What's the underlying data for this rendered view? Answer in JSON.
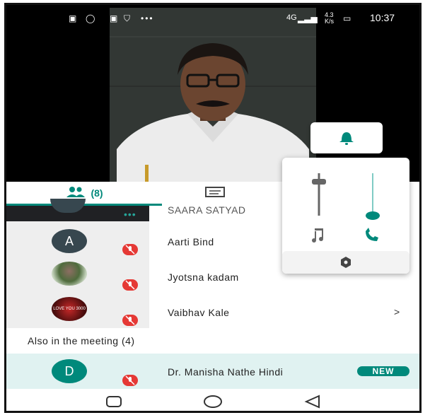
{
  "status_bar": {
    "time": "10:37",
    "network_speed": "4.3\nK/s",
    "signal_label": "4G"
  },
  "colors": {
    "accent": "#00897b",
    "mute_red": "#e53935",
    "also_row_bg": "#e0f2f1"
  },
  "tabs": {
    "people_label": "(8)",
    "people_icon": "people-icon",
    "chat_icon": "chat-icon"
  },
  "participants": [
    {
      "initial": "",
      "name": "SAARA SATYAD",
      "avatar_type": "add"
    },
    {
      "initial": "A",
      "name": "Aarti Bind",
      "avatar_type": "initial"
    },
    {
      "initial": "",
      "name": "Jyotsna kadam",
      "avatar_type": "photo"
    },
    {
      "initial": "",
      "name": "Vaibhav Kale",
      "avatar_type": "photo-text",
      "avatar_text": "LOVE YOU 3000",
      "chevron": ">"
    }
  ],
  "also_section": {
    "heading": "Also in the meeting (4)",
    "rows": [
      {
        "initial": "D",
        "name": "Dr. Manisha Nathe Hindi",
        "badge": "NEW"
      }
    ]
  },
  "volume_popup": {
    "bell_icon": "bell-icon",
    "music_icon": "music-note-icon",
    "phone_icon": "phone-icon",
    "settings_icon": "settings-icon",
    "media_level": 0.95,
    "call_level": 0.0
  }
}
